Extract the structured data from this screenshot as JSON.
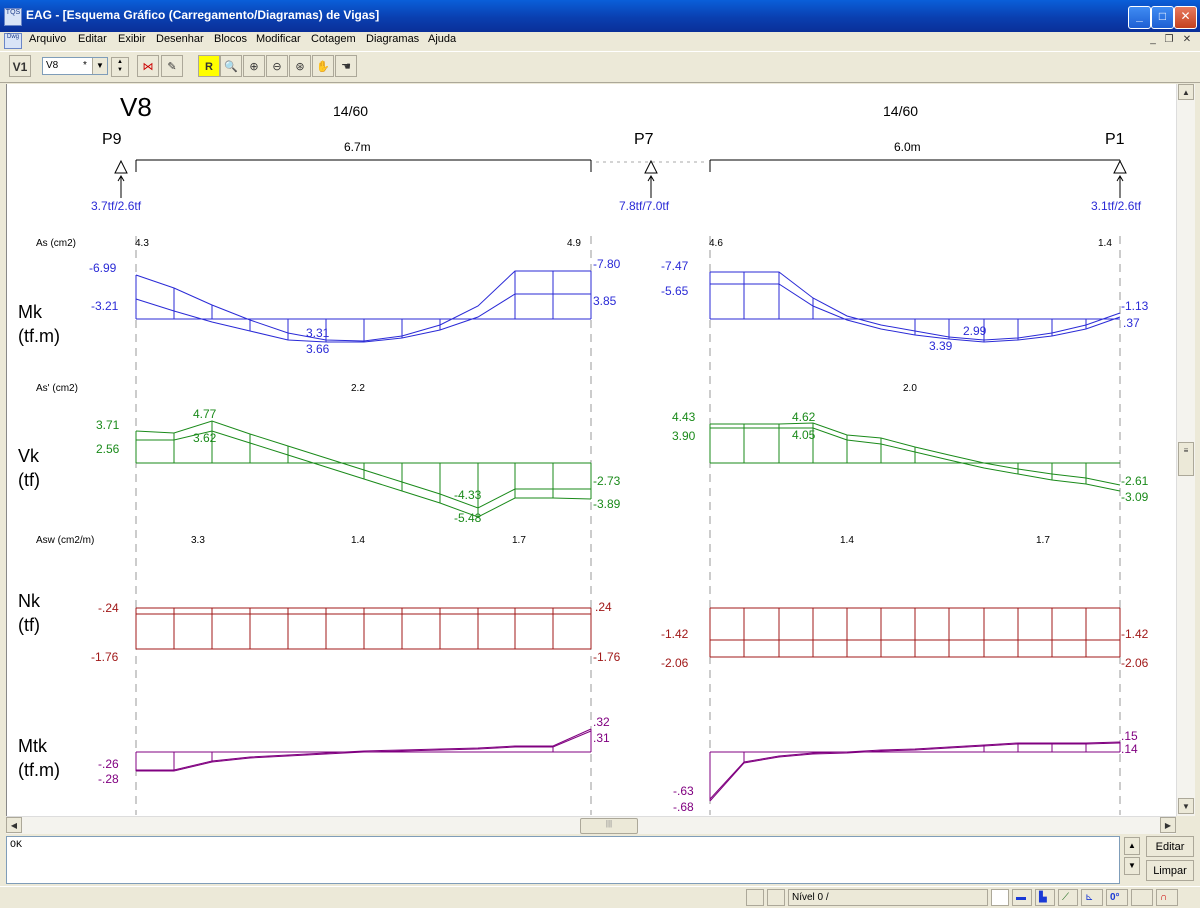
{
  "window": {
    "app_icon": "TQS",
    "title": "EAG - [Esquema Gráfico (Carregamento/Diagramas) de Vigas]",
    "min_icon": "minimize-icon",
    "max_icon": "maximize-icon",
    "close_icon": "close-icon"
  },
  "menu": {
    "mdi_icon": "Dwg",
    "items": [
      "Arquivo",
      "Editar",
      "Exibir",
      "Desenhar",
      "Blocos",
      "Modificar",
      "Cotagem",
      "Diagramas",
      "Ajuda"
    ]
  },
  "toolbar": {
    "v1_label": "V1",
    "beam_select": "V8",
    "beam_select_mark": "*",
    "zoom_btn_label": "R"
  },
  "drawing": {
    "beam_name": "V8",
    "span1": {
      "section": "14/60",
      "length": "6.7m"
    },
    "span2": {
      "section": "14/60",
      "length": "6.0m"
    },
    "supports": [
      {
        "name": "P9",
        "reaction": "3.7tf/2.6tf"
      },
      {
        "name": "P7",
        "reaction": "7.8tf/7.0tf"
      },
      {
        "name": "P1",
        "reaction": "3.1tf/2.6tf"
      }
    ],
    "as_label": "As (cm2)",
    "as_values": [
      "4.3",
      "4.9",
      "4.6",
      "1.4"
    ],
    "mk": {
      "label1": "Mk",
      "label2": "(tf.m)",
      "values": [
        "-6.99",
        "-3.21",
        "3.31",
        "3.66",
        "-7.80",
        "3.85",
        "-7.47",
        "-5.65",
        "2.99",
        "3.39",
        "-1.13",
        ".37"
      ]
    },
    "as2_label": "As' (cm2)",
    "as2_values": [
      "2.2",
      "2.0"
    ],
    "vk": {
      "label1": "Vk",
      "label2": "(tf)",
      "values": [
        "3.71",
        "2.56",
        "4.77",
        "3.62",
        "-4.33",
        "-5.48",
        "-2.73",
        "-3.89",
        "4.43",
        "3.90",
        "4.62",
        "4.05",
        "-2.61",
        "-3.09"
      ]
    },
    "asw_label": "Asw (cm2/m)",
    "asw_values": [
      "3.3",
      "1.4",
      "1.7",
      "1.4",
      "1.7"
    ],
    "nk": {
      "label1": "Nk",
      "label2": "(tf)",
      "values": [
        "-.24",
        "-1.76",
        ".24",
        "-1.76",
        "-1.42",
        "-2.06",
        "-1.42",
        "-2.06"
      ]
    },
    "mtk": {
      "label1": "Mtk",
      "label2": "(tf.m)",
      "values": [
        "-.26",
        "-.28",
        ".32",
        ".31",
        "-.63",
        "-.68",
        ".15",
        ".14"
      ]
    }
  },
  "command": {
    "output": "OK",
    "edit_label": "Editar",
    "clear_label": "Limpar"
  },
  "status": {
    "level": "Nível 0 /",
    "ortho_label": "0°"
  },
  "colors": {
    "mk": "#2a2ad6",
    "vk": "#1a8a1a",
    "nk": "#a01818",
    "mtk": "#800080",
    "titlebar": "#0a46c0"
  }
}
